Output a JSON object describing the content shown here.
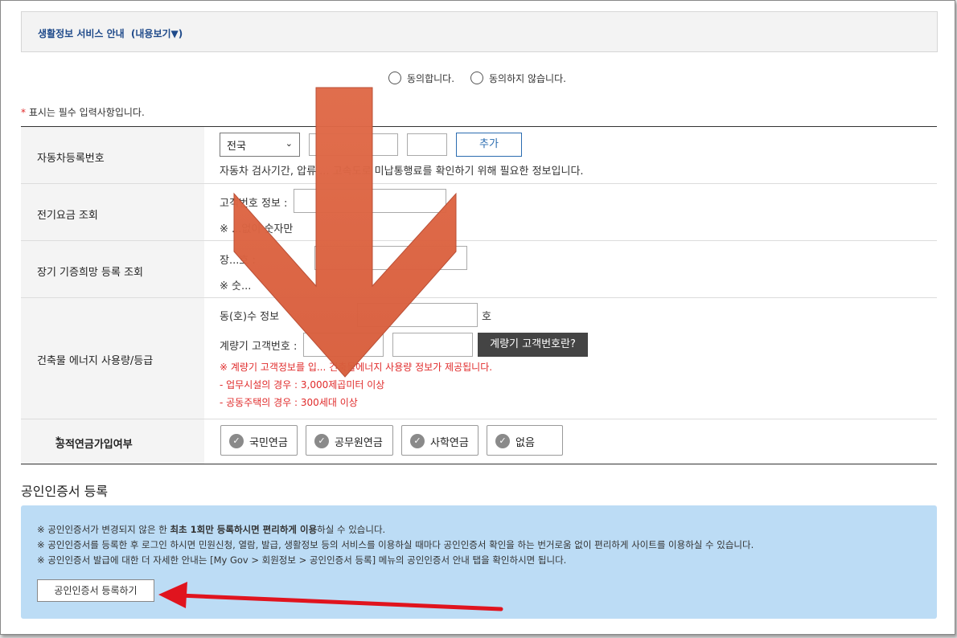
{
  "service": {
    "title": "생활정보 서비스 안내",
    "toggle_label": "(내용보기▼)"
  },
  "consent": {
    "agree_label": "동의합니다.",
    "disagree_label": "동의하지 않습니다."
  },
  "required_note": {
    "marker": "*",
    "text": "표시는 필수 입력사항입니다."
  },
  "rows": {
    "car": {
      "label": "자동차등록번호",
      "region_select": "전국",
      "add_button": "추가",
      "help": "자동차 검사기간, 압류 ... 고속도로 미납통행료를 확인하기 위해 필요한 정보입니다."
    },
    "electric": {
      "label": "전기요금 조회",
      "field_label": "고객번호 정보 :",
      "note": "※ ...없이 숫자만"
    },
    "organ": {
      "label": "장기 기증희망 등록 조회",
      "field_label": "장...호 :",
      "note": "※ 숫..."
    },
    "building": {
      "label": "건축물 에너지 사용량/등급",
      "unit_label": "동(호)수 정보",
      "unit_suffix": "호",
      "meter_label": "계량기 고객번호 :",
      "meter_button": "계량기 고객번호란?",
      "notice1": "※ 계량기 고객정보를 입... 건축물에너지 사용량 정보가 제공됩니다.",
      "notice2": "- 업무시설의 경우 : 3,000제곱미터 이상",
      "notice3": "- 공동주택의 경우 : 300세대 이상"
    },
    "pension": {
      "marker": "*",
      "label": "공적연금가입여부",
      "options": [
        "국민연금",
        "공무원연금",
        "사학연금",
        "없음"
      ]
    }
  },
  "certificate": {
    "heading": "공인인증서 등록",
    "line1_pre": "※ 공인인증서가 변경되지 않은 한 ",
    "line1_bold": "최초 1회만 등록하시면 편리하게 이용",
    "line1_post": "하실 수 있습니다.",
    "line2": "※ 공인인증서를 등록한 후 로그인 하시면 민원신청, 열람, 발급, 생활정보 등의 서비스를 이용하실 때마다 공인인증서 확인을 하는 번거로움 없이 편리하게 사이트를 이용하실 수 있습니다.",
    "line3": "※ 공인인증서 발급에 대한 더 자세한 안내는 [My Gov > 회원정보 > 공인인증서 등록] 메뉴의 공인인증서 안내 탭을 확인하시면 됩니다.",
    "register_button": "공인인증서 등록하기"
  },
  "colors": {
    "accent_blue": "#2b6cb0",
    "required_red": "#e02b2b",
    "cert_bg": "#bcdcf5",
    "overlay_arrow": "#dd6543",
    "red_arrow": "#e0141e"
  }
}
